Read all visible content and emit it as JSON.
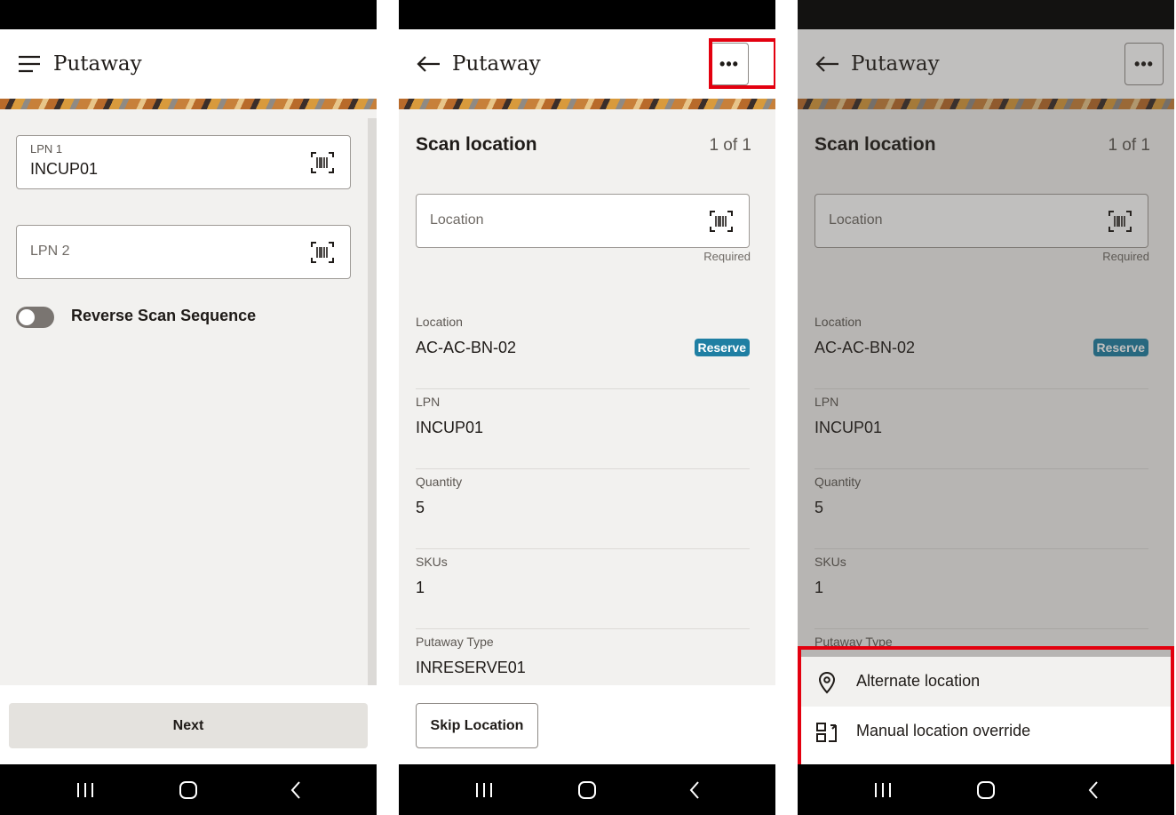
{
  "screen1": {
    "title": "Putaway",
    "lpn1": {
      "label": "LPN 1",
      "value": "INCUP01"
    },
    "lpn2": {
      "placeholder": "LPN 2"
    },
    "reverse_toggle_label": "Reverse Scan Sequence",
    "next_label": "Next"
  },
  "screen2": {
    "title": "Putaway",
    "more_label": "•••",
    "section_title": "Scan location",
    "pager": "1 of 1",
    "location_placeholder": "Location",
    "required_text": "Required",
    "info": [
      {
        "label": "Location",
        "value": "AC-AC-BN-02",
        "badge": "Reserve"
      },
      {
        "label": "LPN",
        "value": "INCUP01"
      },
      {
        "label": "Quantity",
        "value": "5"
      },
      {
        "label": "SKUs",
        "value": "1"
      },
      {
        "label": "Putaway Type",
        "value": "INRESERVE01"
      }
    ],
    "skip_label": "Skip Location"
  },
  "screen3": {
    "title": "Putaway",
    "more_label": "•••",
    "section_title": "Scan location",
    "pager": "1 of 1",
    "location_placeholder": "Location",
    "required_text": "Required",
    "info": [
      {
        "label": "Location",
        "value": "AC-AC-BN-02",
        "badge": "Reserve"
      },
      {
        "label": "LPN",
        "value": "INCUP01"
      },
      {
        "label": "Quantity",
        "value": "5"
      },
      {
        "label": "SKUs",
        "value": "1"
      },
      {
        "label": "Putaway Type"
      }
    ],
    "menu": [
      {
        "label": "Alternate location",
        "icon": "location-pin-icon"
      },
      {
        "label": "Manual location override",
        "icon": "manual-override-icon"
      }
    ]
  },
  "colors": {
    "highlight": "#e3000f",
    "badge": "#1f7fa3",
    "background": "#f2f1ef"
  }
}
